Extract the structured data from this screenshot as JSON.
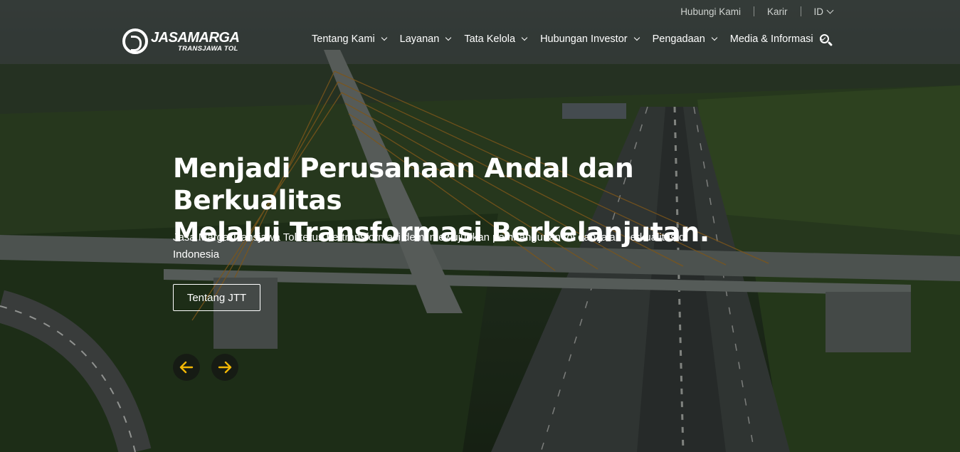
{
  "topbar": {
    "contact": "Hubungi Kami",
    "career": "Karir",
    "language": "ID"
  },
  "logo": {
    "brand": "JASAMARGA",
    "sub": "TRANSJAWA TOL"
  },
  "nav": {
    "items": [
      {
        "label": "Tentang Kami"
      },
      {
        "label": "Layanan"
      },
      {
        "label": "Tata Kelola"
      },
      {
        "label": "Hubungan Investor"
      },
      {
        "label": "Pengadaan"
      },
      {
        "label": "Media & Informasi"
      }
    ]
  },
  "hero": {
    "title_line1": "Menjadi Perusahaan Andal dan Berkualitas",
    "title_line2": "Melalui Transformasi Berkelanjutan.",
    "description": "Jasa Marga Transjawa Tol terus bertransformasi demi mewujudkan pembangunan tol dan jalan berkualitas di Indonesia",
    "cta_label": "Tentang JTT"
  },
  "colors": {
    "accent": "#f2b705",
    "overlay": "rgba(0,0,0,0.38)"
  },
  "icons": {
    "search": "search-icon",
    "prev": "arrow-left-icon",
    "next": "arrow-right-icon",
    "dropdown": "chevron-down-icon"
  }
}
